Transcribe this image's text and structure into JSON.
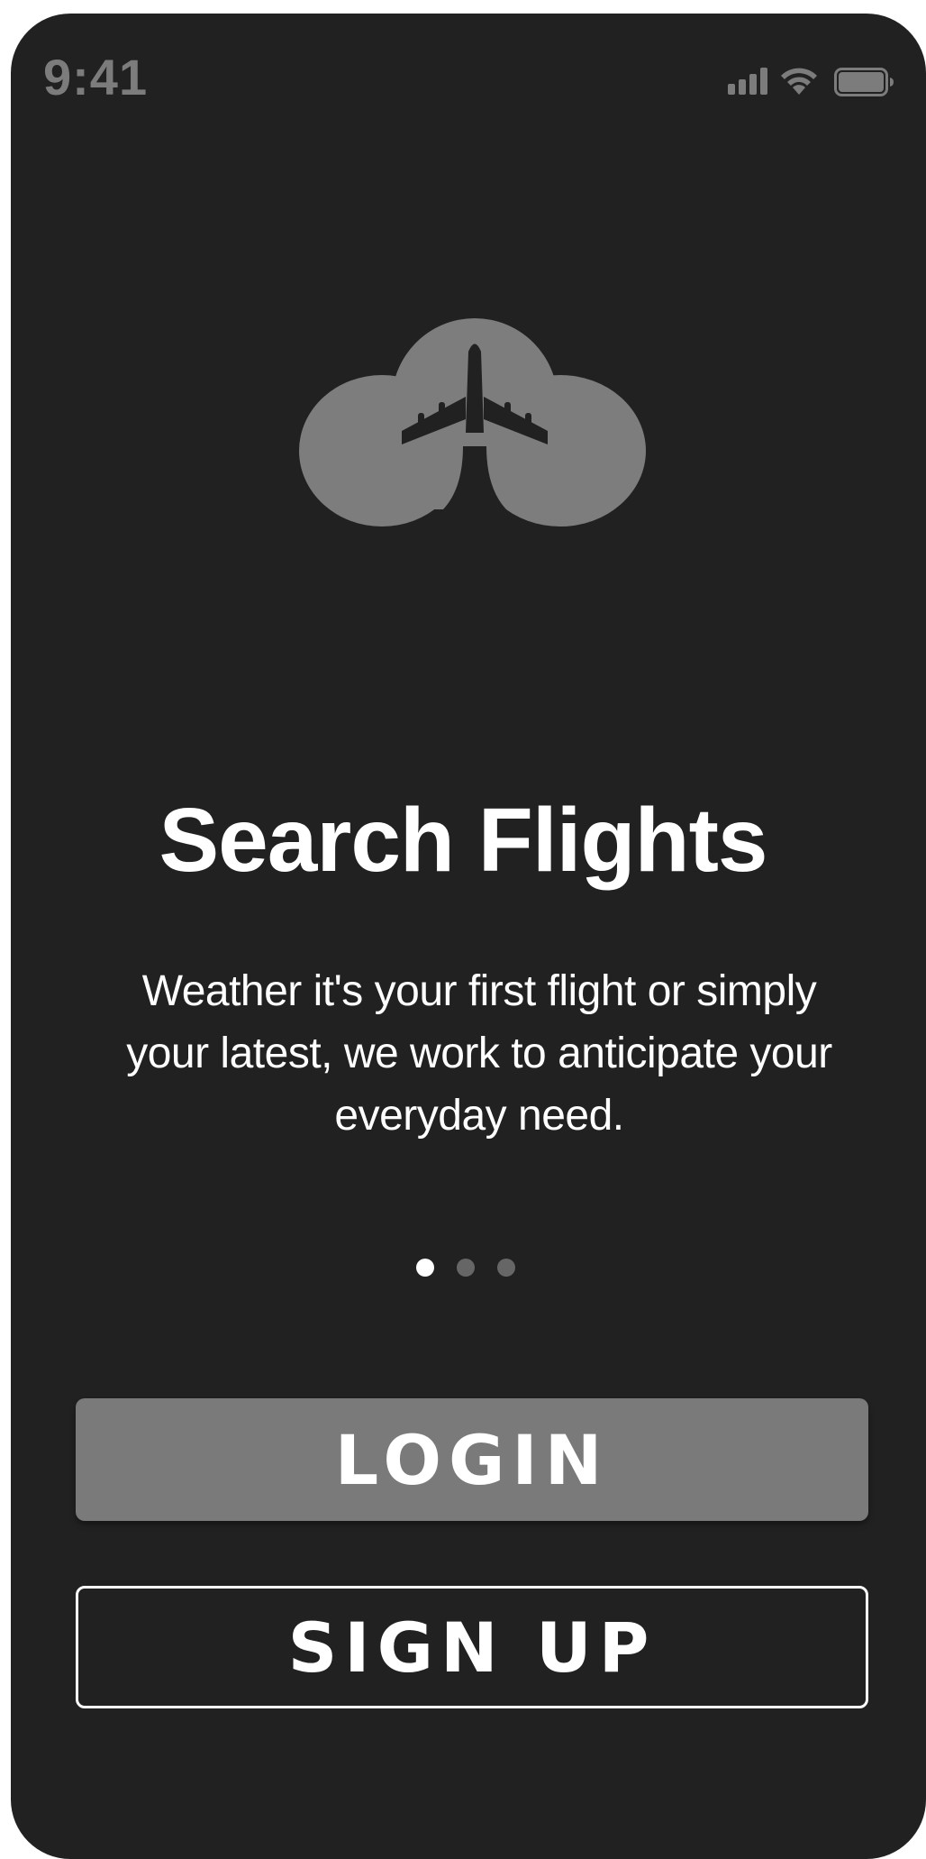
{
  "status_bar": {
    "time": "9:41",
    "icons": [
      "signal-icon",
      "wifi-icon",
      "battery-icon"
    ]
  },
  "logo": {
    "icon": "cloud-airplane-logo-icon"
  },
  "onboarding": {
    "title": "Search Flights",
    "description": "Weather it's your first flight or simply your latest, we work to anticipate your everyday need.",
    "page_indicator": {
      "total": 3,
      "current": 1
    }
  },
  "actions": {
    "login_label": "LOGIN",
    "signup_label": "SIGN UP"
  },
  "colors": {
    "background": "#212121",
    "status_text": "#7c7c7c",
    "logo": "#7d7d7d",
    "primary_button": "#7a7a7a",
    "text": "#ffffff",
    "dot_inactive": "#666666"
  }
}
